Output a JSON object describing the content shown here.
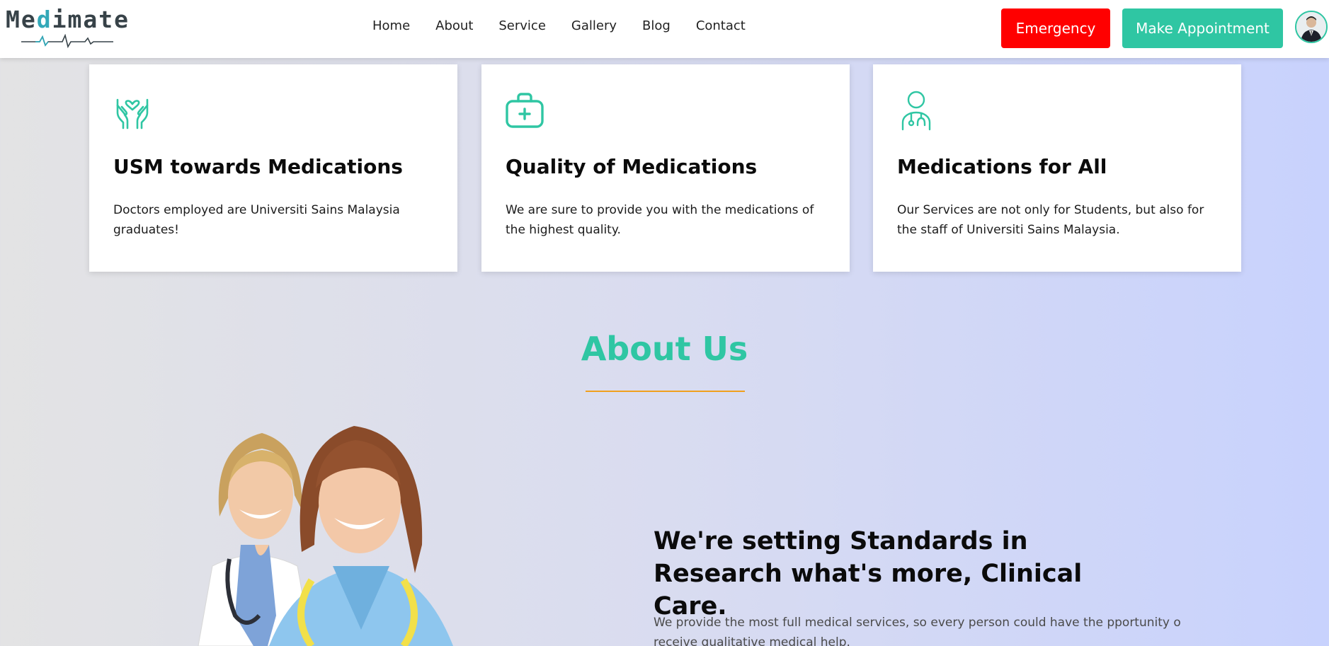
{
  "header": {
    "logo": {
      "text_part1": "Me",
      "text_highlight": "d",
      "text_part2": "imate",
      "icon": "heartbeat-pulse-icon"
    },
    "nav": [
      "Home",
      "About",
      "Service",
      "Gallery",
      "Blog",
      "Contact"
    ],
    "emergency_label": "Emergency",
    "appointment_label": "Make Appointment",
    "avatar_icon": "user-avatar"
  },
  "colors": {
    "accent": "#2fc6a3",
    "emergency": "#ff0000",
    "underline": "#f0a01e"
  },
  "cards": [
    {
      "icon": "hands-heart-icon",
      "title": "USM towards Medications",
      "text": "Doctors employed are Universiti Sains Malaysia graduates!"
    },
    {
      "icon": "medical-kit-icon",
      "title": "Quality of Medications",
      "text": "We are sure to provide you with the medications of the highest quality."
    },
    {
      "icon": "doctor-stethoscope-icon",
      "title": "Medications for All",
      "text": "Our Services are not only for Students, but also for the staff of Universiti Sains Malaysia."
    }
  ],
  "about": {
    "title": "About Us",
    "headline": "We're setting Standards in Research what's more, Clinical Care.",
    "text": "We provide the most full medical services, so every person could have the pportunity o receive qualitative medical help."
  }
}
